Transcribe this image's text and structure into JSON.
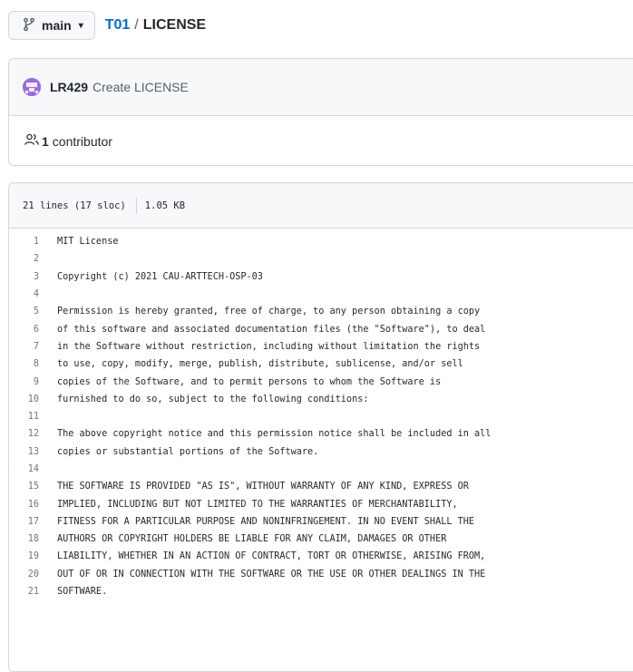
{
  "header": {
    "branch_label": "main",
    "repo": "T01",
    "separator": "/",
    "file": "LICENSE"
  },
  "commit": {
    "author": "LR429",
    "message": "Create LICENSE",
    "contributors_count": "1",
    "contributors_label": "contributor"
  },
  "file": {
    "lines_info": "21 lines (17 sloc)",
    "size": "1.05 KB",
    "lines": [
      "MIT License",
      "",
      "Copyright (c) 2021 CAU-ARTTECH-OSP-03",
      "",
      "Permission is hereby granted, free of charge, to any person obtaining a copy",
      "of this software and associated documentation files (the \"Software\"), to deal",
      "in the Software without restriction, including without limitation the rights",
      "to use, copy, modify, merge, publish, distribute, sublicense, and/or sell",
      "copies of the Software, and to permit persons to whom the Software is",
      "furnished to do so, subject to the following conditions:",
      "",
      "The above copyright notice and this permission notice shall be included in all",
      "copies or substantial portions of the Software.",
      "",
      "THE SOFTWARE IS PROVIDED \"AS IS\", WITHOUT WARRANTY OF ANY KIND, EXPRESS OR",
      "IMPLIED, INCLUDING BUT NOT LIMITED TO THE WARRANTIES OF MERCHANTABILITY,",
      "FITNESS FOR A PARTICULAR PURPOSE AND NONINFRINGEMENT. IN NO EVENT SHALL THE",
      "AUTHORS OR COPYRIGHT HOLDERS BE LIABLE FOR ANY CLAIM, DAMAGES OR OTHER",
      "LIABILITY, WHETHER IN AN ACTION OF CONTRACT, TORT OR OTHERWISE, ARISING FROM,",
      "OUT OF OR IN CONNECTION WITH THE SOFTWARE OR THE USE OR OTHER DEALINGS IN THE",
      "SOFTWARE."
    ]
  },
  "colors": {
    "link": "#0969da",
    "avatar": "#9b6dd8",
    "border": "#d0d7de",
    "header_bg": "#f6f8fa"
  },
  "icons": {
    "branch": "git-branch-icon",
    "caret": "caret-down-icon",
    "people": "people-icon",
    "avatar": "identicon-avatar"
  }
}
